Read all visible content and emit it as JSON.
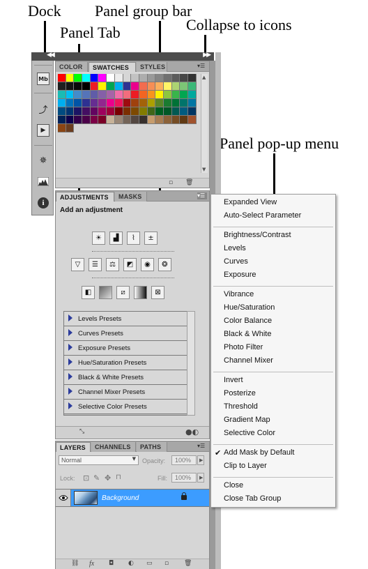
{
  "callouts": {
    "dock": "Dock",
    "panel_group_bar": "Panel group bar",
    "panel_tab": "Panel Tab",
    "collapse_to_icons": "Collapse to icons",
    "panel_popup_menu": "Panel pop-up menu"
  },
  "swatch_panel": {
    "tabs": [
      "COLOR",
      "SWATCHES",
      "STYLES"
    ],
    "active_tab": "SWATCHES",
    "swatch_colors": [
      "#ff0000",
      "#ffff00",
      "#00ff00",
      "#00ffff",
      "#0000ff",
      "#ff00ff",
      "#ffffff",
      "#ebebeb",
      "#d6d6d6",
      "#c2c2c2",
      "#adadad",
      "#999999",
      "#858585",
      "#707070",
      "#5c5c5c",
      "#474747",
      "#333333",
      "#1f1f1f",
      "#141414",
      "#0a0a0a",
      "#000000",
      "#ed1c24",
      "#fff200",
      "#00a651",
      "#00aeef",
      "#2e3192",
      "#ec008c",
      "#f26c4f",
      "#f68e55",
      "#fbaf5c",
      "#fff467",
      "#acd372",
      "#7cc576",
      "#3bb878",
      "#1abbb4",
      "#00bff3",
      "#438ccb",
      "#5574b9",
      "#605ca8",
      "#855fa8",
      "#a763a8",
      "#f06ea9",
      "#f26d7d",
      "#ed1c24",
      "#f26522",
      "#f7941d",
      "#fff200",
      "#8dc63f",
      "#39b54a",
      "#00a651",
      "#00a99d",
      "#00aeef",
      "#0072bc",
      "#0054a6",
      "#2e3192",
      "#662d91",
      "#92278f",
      "#ec008c",
      "#ed145b",
      "#9e0b0f",
      "#a0410d",
      "#a36209",
      "#aba000",
      "#598527",
      "#1a7b30",
      "#007236",
      "#00746b",
      "#0076a3",
      "#004b80",
      "#003471",
      "#1b1464",
      "#440e62",
      "#630460",
      "#9e005d",
      "#9e0039",
      "#790000",
      "#7b2e00",
      "#7d4900",
      "#827b00",
      "#406618",
      "#005e20",
      "#005826",
      "#005952",
      "#005b7f",
      "#003663",
      "#002157",
      "#0d004c",
      "#32004b",
      "#4b0049",
      "#7b0046",
      "#7a0026",
      "#c7b299",
      "#998675",
      "#736357",
      "#534741",
      "#37302d",
      "#c69c6d",
      "#a67c52",
      "#8c6239",
      "#754c24",
      "#603913",
      "#a0522d"
    ],
    "extra_swatches": [
      "#8b4513",
      "#6b3d1f"
    ]
  },
  "dock_icons": [
    "mini-bridge-icon",
    "history-icon",
    "actions-icon",
    "navigator-icon",
    "histogram-icon",
    "info-icon"
  ],
  "adjustments_panel": {
    "tabs": [
      "ADJUSTMENTS",
      "MASKS"
    ],
    "active_tab": "ADJUSTMENTS",
    "heading": "Add an adjustment",
    "presets": [
      "Levels Presets",
      "Curves Presets",
      "Exposure Presets",
      "Hue/Saturation Presets",
      "Black & White Presets",
      "Channel Mixer Presets",
      "Selective Color Presets"
    ]
  },
  "layers_panel": {
    "tabs": [
      "LAYERS",
      "CHANNELS",
      "PATHS"
    ],
    "active_tab": "LAYERS",
    "blend_mode": "Normal",
    "opacity_label": "Opacity:",
    "opacity_value": "100%",
    "lock_label": "Lock:",
    "fill_label": "Fill:",
    "fill_value": "100%",
    "layer_name": "Background",
    "selected_color": "#3c9cff"
  },
  "popup_menu": {
    "group1": [
      "Expanded View",
      "Auto-Select Parameter"
    ],
    "group2": [
      "Brightness/Contrast",
      "Levels",
      "Curves",
      "Exposure"
    ],
    "group3": [
      "Vibrance",
      "Hue/Saturation",
      "Color Balance",
      "Black & White",
      "Photo Filter",
      "Channel Mixer"
    ],
    "group4": [
      "Invert",
      "Posterize",
      "Threshold",
      "Gradient Map",
      "Selective Color"
    ],
    "group5": [
      "Add Mask by Default",
      "Clip to Layer"
    ],
    "group6": [
      "Close",
      "Close Tab Group"
    ],
    "checked_item": "Add Mask by Default"
  }
}
